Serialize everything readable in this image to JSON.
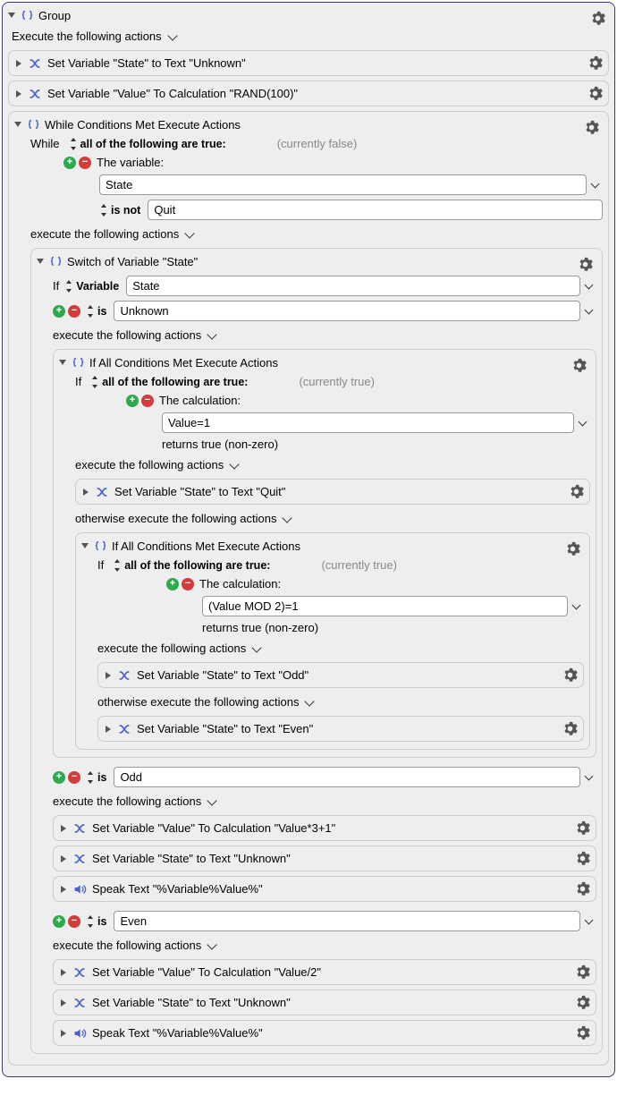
{
  "group": {
    "title": "Group",
    "exec_label": "Execute the following actions",
    "actions": {
      "set_state_unknown": "Set Variable \"State\" to Text \"Unknown\"",
      "set_value_rand": "Set Variable \"Value\" To Calculation \"RAND(100)\""
    }
  },
  "while": {
    "title": "While Conditions Met Execute Actions",
    "while_label": "While",
    "all_true": "all of the following are true:",
    "currently_false": "(currently false)",
    "the_variable": "The variable:",
    "var_value": "State",
    "is_not": "is not",
    "cmp_value": "Quit",
    "exec_label": "execute the following actions"
  },
  "switch": {
    "title": "Switch of Variable \"State\"",
    "if_label": "If",
    "variable_label": "Variable",
    "var_value": "State",
    "case1": {
      "is_label": "is",
      "value": "Unknown",
      "exec_label": "execute the following actions"
    },
    "case2": {
      "is_label": "is",
      "value": "Odd",
      "exec_label": "execute the following actions",
      "actions": {
        "a1": "Set Variable \"Value\" To Calculation \"Value*3+1\"",
        "a2": "Set Variable \"State\" to Text \"Unknown\"",
        "a3": "Speak Text \"%Variable%Value%\""
      }
    },
    "case3": {
      "is_label": "is",
      "value": "Even",
      "exec_label": "execute the following actions",
      "actions": {
        "a1": "Set Variable \"Value\" To Calculation \"Value/2\"",
        "a2": "Set Variable \"State\" to Text \"Unknown\"",
        "a3": "Speak Text \"%Variable%Value%\""
      }
    }
  },
  "if1": {
    "title": "If All Conditions Met Execute Actions",
    "if_label": "If",
    "all_true": "all of the following are true:",
    "currently_true": "(currently true)",
    "the_calc": "The calculation:",
    "calc_value": "Value=1",
    "returns": "returns true (non-zero)",
    "exec_label": "execute the following actions",
    "otherwise_label": "otherwise execute the following actions",
    "then_action": "Set Variable \"State\" to Text \"Quit\""
  },
  "if2": {
    "title": "If All Conditions Met Execute Actions",
    "if_label": "If",
    "all_true": "all of the following are true:",
    "currently_true": "(currently true)",
    "the_calc": "The calculation:",
    "calc_value": "(Value MOD 2)=1",
    "returns": "returns true (non-zero)",
    "exec_label": "execute the following actions",
    "otherwise_label": "otherwise execute the following actions",
    "then_action": "Set Variable \"State\" to Text \"Odd\"",
    "else_action": "Set Variable \"State\" to Text \"Even\""
  }
}
